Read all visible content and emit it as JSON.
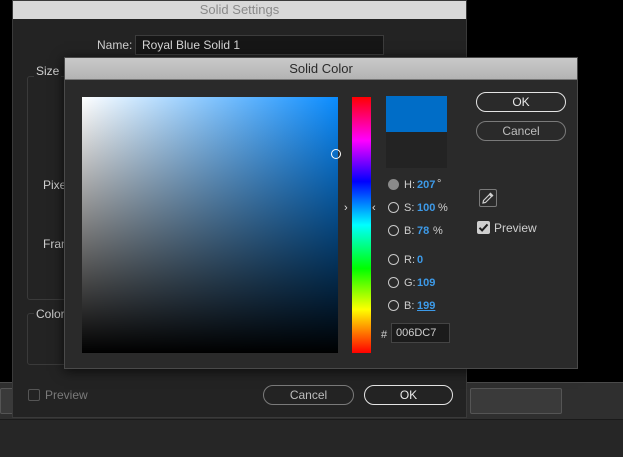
{
  "settings_dialog": {
    "title": "Solid Settings",
    "name_label": "Name:",
    "name_value": "Royal Blue Solid 1",
    "group_size": "Size",
    "group_pixel": "Pixel",
    "group_frame": "Fram",
    "group_color": "Color",
    "preview_label": "Preview",
    "cancel_label": "Cancel",
    "ok_label": "OK"
  },
  "color_dialog": {
    "title": "Solid Color",
    "hsb": [
      {
        "label": "H:",
        "value": "207",
        "unit": "°"
      },
      {
        "label": "S:",
        "value": "100",
        "unit": "%"
      },
      {
        "label": "B:",
        "value": "78",
        "unit": "%"
      }
    ],
    "rgb": [
      {
        "label": "R:",
        "value": "0"
      },
      {
        "label": "G:",
        "value": "109"
      },
      {
        "label": "B:",
        "value": "199"
      }
    ],
    "hex_symbol": "#",
    "hex_value": "006DC7",
    "ok_label": "OK",
    "cancel_label": "Cancel",
    "preview_label": "Preview",
    "preview_checked": true,
    "selected_channel": "H",
    "colors": {
      "new_color": "#006DC7",
      "original_color": "#232323",
      "hue_color": "#0A8CFF",
      "value_text": "#3D9AE8"
    }
  }
}
